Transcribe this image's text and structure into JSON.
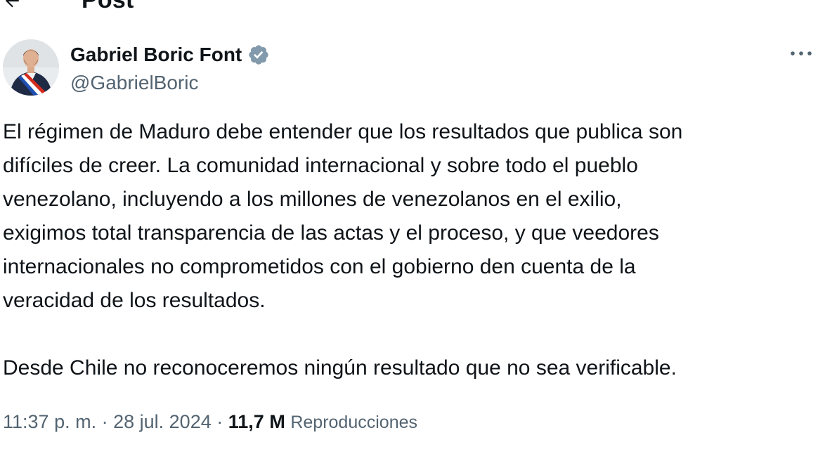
{
  "header": {
    "title": "Post",
    "back_icon": "arrow-left-icon"
  },
  "author": {
    "display_name": "Gabriel Boric Font",
    "handle": "@GabrielBoric",
    "verified_icon": "verified-badge-icon",
    "verified_color": "#829aab",
    "avatar": "profile-photo"
  },
  "post": {
    "paragraphs": [
      "El régimen de Maduro debe entender que los resultados que publica son\ndifíciles de creer. La comunidad internacional y sobre todo el pueblo\nvenezolano, incluyendo a los millones de venezolanos en el exilio,\nexigimos total transparencia de las actas y el proceso, y que veedores\ninternacionales no comprometidos con el gobierno den cuenta de la\nveracidad de los resultados.",
      "Desde Chile no reconoceremos ningún resultado que no sea verificable."
    ],
    "more_icon": "more-horizontal-icon"
  },
  "meta": {
    "time": "11:37 p. m.",
    "separator": "·",
    "date": "28 jul. 2024",
    "views_count": "11,7 M",
    "views_label": "Reproducciones"
  },
  "colors": {
    "text": "#0f1419",
    "secondary": "#536471"
  }
}
